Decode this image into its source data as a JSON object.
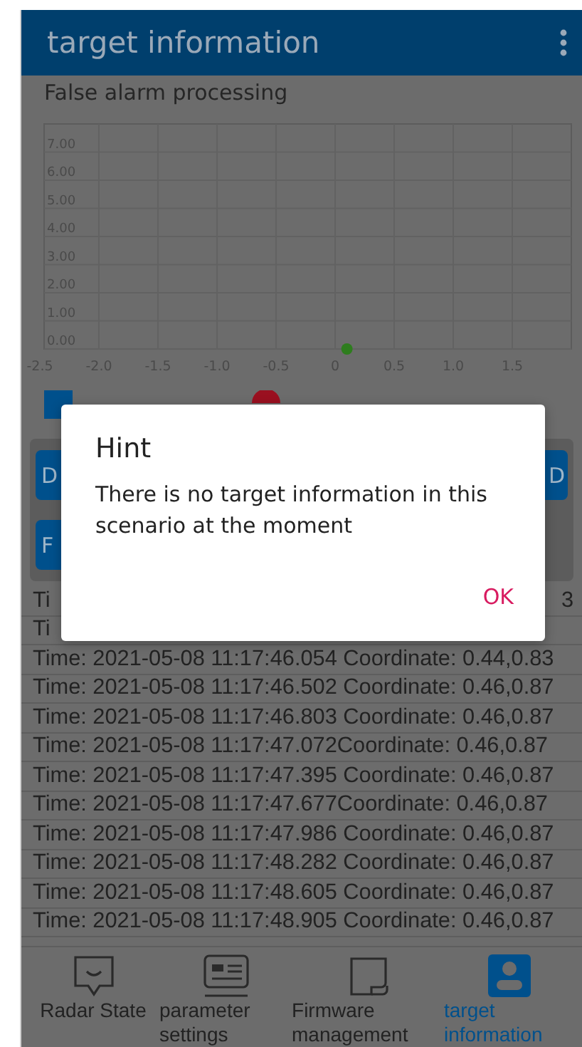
{
  "header": {
    "title": "target information"
  },
  "subtitle": "False alarm processing",
  "chart": {
    "chart_data": {
      "type": "scatter",
      "x": [
        0.1
      ],
      "series": [
        {
          "color": "#2e7d1e",
          "values": [
            0
          ]
        }
      ],
      "xlim": [
        -2.5,
        2.0
      ],
      "ylim": [
        0,
        8
      ],
      "grid": true,
      "xticks": [
        {
          "value": -2.5,
          "label": "-2.5"
        },
        {
          "value": -2.0,
          "label": "-2.0"
        },
        {
          "value": -1.5,
          "label": "-1.5"
        },
        {
          "value": -1.0,
          "label": "-1.0"
        },
        {
          "value": -0.5,
          "label": "-0.5"
        },
        {
          "value": 0,
          "label": "0"
        },
        {
          "value": 0.5,
          "label": "0.5"
        },
        {
          "value": 1.0,
          "label": "1.0"
        },
        {
          "value": 1.5,
          "label": "1.5"
        }
      ],
      "yticks": [
        {
          "value": 0,
          "label": "0.00"
        },
        {
          "value": 1,
          "label": "1.00"
        },
        {
          "value": 2,
          "label": "2.00"
        },
        {
          "value": 3,
          "label": "3.00"
        },
        {
          "value": 4,
          "label": "4.00"
        },
        {
          "value": 5,
          "label": "5.00"
        },
        {
          "value": 6,
          "label": "6.00"
        },
        {
          "value": 7,
          "label": "7.00"
        }
      ]
    }
  },
  "legend": [
    {
      "kind": "square",
      "color": "#00508c"
    },
    {
      "kind": "circle",
      "color": "#9a1020"
    }
  ],
  "buttons": [
    {
      "label": "D"
    },
    {
      "label": "D"
    },
    {
      "label": "F"
    }
  ],
  "rows": [
    {
      "text": "Ti",
      "tail": "3"
    },
    {
      "text": "Ti"
    },
    {
      "text": "Time: 2021-05-08 11:17:46.054 Coordinate: 0.44,0.83"
    },
    {
      "text": "Time: 2021-05-08 11:17:46.502 Coordinate: 0.46,0.87"
    },
    {
      "text": "Time: 2021-05-08 11:17:46.803 Coordinate: 0.46,0.87"
    },
    {
      "text": "Time: 2021-05-08 11:17:47.072Coordinate: 0.46,0.87"
    },
    {
      "text": "Time: 2021-05-08 11:17:47.395 Coordinate: 0.46,0.87"
    },
    {
      "text": "Time: 2021-05-08 11:17:47.677Coordinate: 0.46,0.87"
    },
    {
      "text": "Time: 2021-05-08 11:17:47.986 Coordinate: 0.46,0.87"
    },
    {
      "text": "Time: 2021-05-08 11:17:48.282 Coordinate: 0.46,0.87"
    },
    {
      "text": "Time: 2021-05-08 11:17:48.605 Coordinate: 0.46,0.87"
    },
    {
      "text": "Time: 2021-05-08 11:17:48.905 Coordinate: 0.46,0.87"
    }
  ],
  "nav": [
    {
      "kind": "radar",
      "label": "Radar State",
      "selected": false
    },
    {
      "kind": "params",
      "label": "parameter settings",
      "selected": false
    },
    {
      "kind": "firmware",
      "label": "Firmware management",
      "selected": false
    },
    {
      "kind": "target",
      "label": "target information",
      "selected": true
    }
  ],
  "dialog": {
    "title": "Hint",
    "message": "There is no target information in this scenario at the moment",
    "button": "OK"
  }
}
